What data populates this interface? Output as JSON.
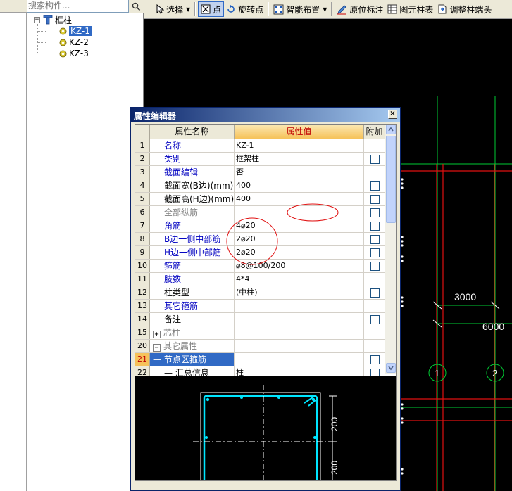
{
  "search": {
    "placeholder": "搜索构件..."
  },
  "tree": {
    "root": {
      "toggle": "−",
      "label": "框柱"
    },
    "items": [
      {
        "label": "KZ-1",
        "selected": true
      },
      {
        "label": "KZ-2",
        "selected": false
      },
      {
        "label": "KZ-3",
        "selected": false
      }
    ]
  },
  "toolbar": {
    "select": "选择",
    "point": "点",
    "rotate_point": "旋转点",
    "smart_layout": "智能布置",
    "in_situ_mark": "原位标注",
    "column_table": "图元柱表",
    "adjust_column_end": "调整柱端头"
  },
  "canvas": {
    "dim_3000": "3000",
    "dim_6000": "6000",
    "axis_1": "1",
    "axis_2": "2",
    "colors": {
      "green": "#00cc33",
      "red": "#e01010",
      "white": "#ffffff"
    }
  },
  "editor": {
    "title": "属性编辑器",
    "close": "×",
    "headers": {
      "name": "属性名称",
      "value": "属性值",
      "extra": "附加"
    },
    "rows": [
      {
        "num": "1",
        "name": "名称",
        "value": "KZ-1",
        "style": "blue",
        "check": false
      },
      {
        "num": "2",
        "name": "类别",
        "value": "框架柱",
        "style": "blue",
        "check": true
      },
      {
        "num": "3",
        "name": "截面编辑",
        "value": "否",
        "style": "blue",
        "check": false
      },
      {
        "num": "4",
        "name": "截面宽(B边)(mm)",
        "value": "400",
        "style": "black",
        "check": true
      },
      {
        "num": "5",
        "name": "截面高(H边)(mm)",
        "value": "400",
        "style": "black",
        "check": true
      },
      {
        "num": "6",
        "name": "全部纵筋",
        "value": "",
        "style": "gray",
        "check": true
      },
      {
        "num": "7",
        "name": "角筋",
        "value": "4⌀20",
        "style": "blue",
        "check": true
      },
      {
        "num": "8",
        "name": "B边一侧中部筋",
        "value": "2⌀20",
        "style": "blue",
        "check": true
      },
      {
        "num": "9",
        "name": "H边一侧中部筋",
        "value": "2⌀20",
        "style": "blue",
        "check": true
      },
      {
        "num": "10",
        "name": "箍筋",
        "value": "⌀8@100/200",
        "style": "blue",
        "check": true
      },
      {
        "num": "11",
        "name": "肢数",
        "value": "4*4",
        "style": "blue",
        "check": false
      },
      {
        "num": "12",
        "name": "柱类型",
        "value": "(中柱)",
        "style": "black",
        "check": true
      },
      {
        "num": "13",
        "name": "其它箍筋",
        "value": "",
        "style": "blue",
        "check": false
      },
      {
        "num": "14",
        "name": "备注",
        "value": "",
        "style": "black",
        "check": true
      },
      {
        "num": "15",
        "name": "芯柱",
        "value": "",
        "style": "gray",
        "check": false,
        "expand": "+"
      },
      {
        "num": "20",
        "name": "其它属性",
        "value": "",
        "style": "gray",
        "check": false,
        "expand": "−"
      },
      {
        "num": "21",
        "name": "— 节点区箍筋",
        "value": "",
        "style": "blue",
        "check": true,
        "selected": true
      },
      {
        "num": "22",
        "name": "— 汇总信息",
        "value": "柱",
        "style": "black",
        "check": true
      }
    ],
    "preview": {
      "dim_200": "200",
      "dim_200b": "200"
    }
  }
}
